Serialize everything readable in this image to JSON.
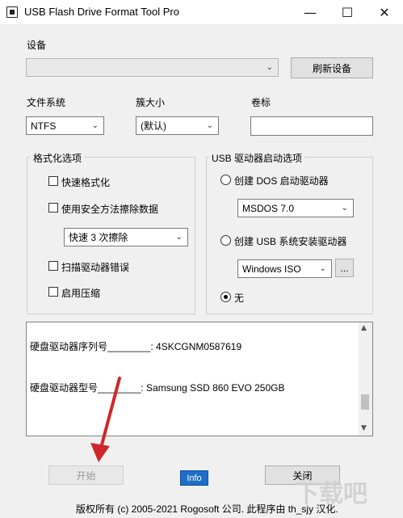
{
  "window": {
    "title": "USB Flash Drive Format Tool Pro",
    "minimize_glyph": "—",
    "maximize_glyph": "☐",
    "close_glyph": "✕"
  },
  "device": {
    "label": "设备",
    "selected": "",
    "refresh_label": "刷新设备"
  },
  "filesystem": {
    "label": "文件系统",
    "selected": "NTFS"
  },
  "cluster": {
    "label": "簇大小",
    "selected": "(默认)"
  },
  "volume": {
    "label": "卷标",
    "value": ""
  },
  "format_options": {
    "title": "格式化选项",
    "quick_format": {
      "label": "快速格式化",
      "checked": false
    },
    "secure_erase": {
      "label": "使用安全方法擦除数据",
      "checked": false
    },
    "erase_mode": "快速 3 次擦除",
    "scan_errors": {
      "label": "扫描驱动器错误",
      "checked": false
    },
    "compression": {
      "label": "启用压缩",
      "checked": false
    }
  },
  "usb_boot": {
    "title": "USB 驱动器启动选项",
    "dos": {
      "label": "创建 DOS 启动驱动器",
      "checked": false
    },
    "dos_version": "MSDOS 7.0",
    "install": {
      "label": "创建 USB 系统安装驱动器",
      "checked": false
    },
    "install_source": "Windows ISO",
    "browse_label": "...",
    "none": {
      "label": "无",
      "checked": true
    }
  },
  "info": {
    "line1": "硬盘驱动器序列号________: 4SKCGNM0587619",
    "line2": "硬盘驱动器型号________: Samsung SSD 860 EVO 250GB"
  },
  "buttons": {
    "start": "开始",
    "info": "Info",
    "close": "关闭"
  },
  "footer": "版权所有 (c) 2005-2021 Rogosoft 公司.   此程序由 th_sjy 汉化.",
  "watermark": "下载吧",
  "colors": {
    "annotation_arrow": "#d0262b",
    "info_button": "#1e6fc8"
  }
}
